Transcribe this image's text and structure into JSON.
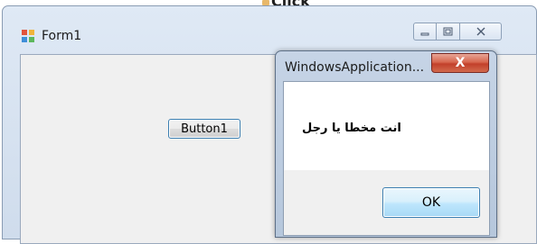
{
  "background": {
    "partial_text": "Click"
  },
  "form": {
    "title": "Form1",
    "icon": "form-app-icon",
    "caption_buttons": [
      "minimize-icon",
      "maximize-icon",
      "close-icon"
    ],
    "button1_label": "Button1"
  },
  "messagebox": {
    "title": "WindowsApplication...",
    "close_glyph": "X",
    "message": "انت مخطا يا رجل",
    "ok_label": "OK"
  },
  "colors": {
    "frame_blue": "#cfdcec",
    "close_red": "#c2402a",
    "ok_blue": "#bee6fd"
  }
}
